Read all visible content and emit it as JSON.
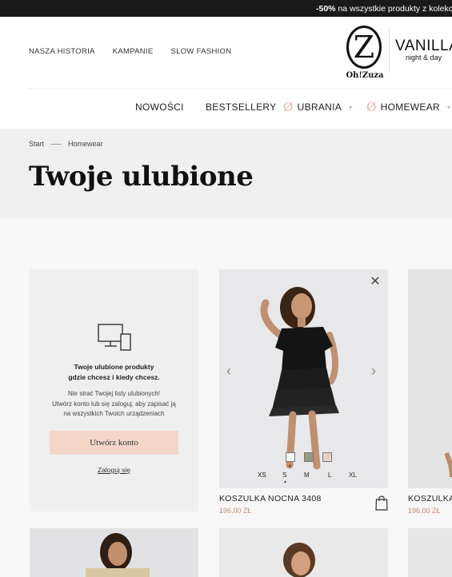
{
  "promo": {
    "highlight": "-50%",
    "text": " na wszystkie produkty z kolekcji wi"
  },
  "topnav": {
    "items": [
      "NASZA HISTORIA",
      "KAMPANIE",
      "SLOW FASHION"
    ]
  },
  "logo": {
    "mark": "Z",
    "wordmark": "Oh!Zuza"
  },
  "brand2": {
    "name": "VANILLA",
    "tagline": "night & day"
  },
  "mainnav": {
    "items": [
      "NOWOŚCI",
      "BESTSELLERY",
      "UBRANIA",
      "HOMEWEAR"
    ]
  },
  "breadcrumb": {
    "items": [
      "Start",
      "Homewear"
    ]
  },
  "page": {
    "title": "Twoje ulubione"
  },
  "info": {
    "title_line1": "Twoje ulubione produkty",
    "title_line2": "gdzie chcesz i kiedy chcesz.",
    "desc_line1": "Nie strać Twojej listy ulubionych!",
    "desc_line2": "Utwórz konto lub się zaloguj, aby zapisać ją",
    "desc_line3": "na wszystkich Twoich urządzeniach",
    "create_label": "Utwórz konto",
    "login_label": "Zaloguj się"
  },
  "product": {
    "name": "KOSZULKA NOCNA 3408",
    "price": "196,00 ZŁ",
    "colors": [
      "#f5f5f5",
      "#9a9a84",
      "#e6d1c6"
    ],
    "selected_color_index": 0,
    "sizes": [
      "XS",
      "S",
      "M",
      "L",
      "XL"
    ],
    "selected_size": "S"
  },
  "product_peek": {
    "name": "KOSZULKA",
    "price": "196,00 ZŁ"
  }
}
